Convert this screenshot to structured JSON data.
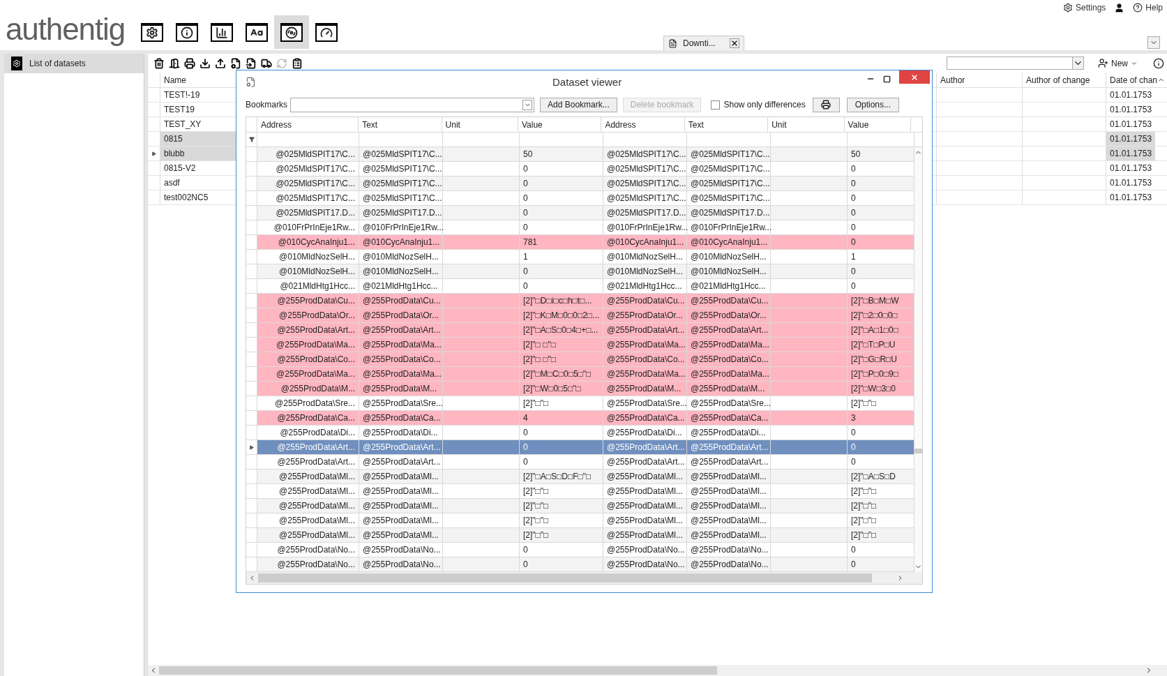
{
  "header": {
    "logo": "authentig",
    "links": [
      {
        "kind": "settings",
        "label": "Settings"
      },
      {
        "kind": "help",
        "label": "Help"
      }
    ]
  },
  "module_tabs": [
    {
      "kind": "settings",
      "selected": false
    },
    {
      "kind": "info",
      "selected": false
    },
    {
      "kind": "chart",
      "selected": false
    },
    {
      "kind": "font",
      "selected": false
    },
    {
      "kind": "disc",
      "selected": true
    },
    {
      "kind": "clock",
      "selected": false
    }
  ],
  "doc_tabs": [
    {
      "label": "Downti..."
    }
  ],
  "sidebar": {
    "items": [
      {
        "label": "List of datasets",
        "selected": true
      }
    ]
  },
  "toolbar": {
    "new_button": "New"
  },
  "main_grid": {
    "columns": [
      "Name",
      "Author",
      "Author of change",
      "Date of chan"
    ],
    "rows": [
      {
        "name": "TEST!-19",
        "date": "01.01.1753",
        "selected": false,
        "current": false
      },
      {
        "name": "TEST19",
        "date": "01.01.1753",
        "selected": false,
        "current": false
      },
      {
        "name": "TEST_XY",
        "date": "01.01.1753",
        "selected": false,
        "current": false
      },
      {
        "name": "0815",
        "date": "01.01.1753",
        "selected": true,
        "current": false
      },
      {
        "name": "blubb",
        "date": "01.01.1753",
        "selected": true,
        "current": true
      },
      {
        "name": "0815-V2",
        "date": "01.01.1753",
        "selected": false,
        "current": false
      },
      {
        "name": "asdf",
        "date": "01.01.1753",
        "selected": false,
        "current": false
      },
      {
        "name": "test002NC5",
        "date": "01.01.1753",
        "selected": false,
        "current": false
      }
    ]
  },
  "dialog": {
    "title": "Dataset viewer",
    "bookmarks_label": "Bookmarks",
    "buttons": [
      {
        "label": "Add Bookmark...",
        "disabled": false
      },
      {
        "label": "Delete bookmark",
        "disabled": true
      }
    ],
    "show_only_differences": {
      "label": "Show only differences",
      "checked": false
    },
    "options_button": "Options...",
    "columns": [
      "Address",
      "Text",
      "Unit",
      "Value",
      "Address",
      "Text",
      "Unit",
      "Value"
    ],
    "rows": [
      {
        "address": "@025MldSPIT17\\C...",
        "text": "@025MldSPIT17\\C...",
        "value": "50",
        "address_2": "@025MldSPIT17\\C...",
        "text_2": "@025MldSPIT17\\C...",
        "value_2": "50",
        "differs": false,
        "selected": false
      },
      {
        "address": "@025MldSPIT17\\C...",
        "text": "@025MldSPIT17\\C...",
        "value": "0",
        "address_2": "@025MldSPIT17\\C...",
        "text_2": "@025MldSPIT17\\C...",
        "value_2": "0",
        "differs": false,
        "selected": false
      },
      {
        "address": "@025MldSPIT17\\C...",
        "text": "@025MldSPIT17\\C...",
        "value": "0",
        "address_2": "@025MldSPIT17\\C...",
        "text_2": "@025MldSPIT17\\C...",
        "value_2": "0",
        "differs": false,
        "selected": false
      },
      {
        "address": "@025MldSPIT17\\C...",
        "text": "@025MldSPIT17\\C...",
        "value": "0",
        "address_2": "@025MldSPIT17\\C...",
        "text_2": "@025MldSPIT17\\C...",
        "value_2": "0",
        "differs": false,
        "selected": false
      },
      {
        "address": "@025MldSPIT17.D...",
        "text": "@025MldSPIT17.D...",
        "value": "0",
        "address_2": "@025MldSPIT17.D...",
        "text_2": "@025MldSPIT17.D...",
        "value_2": "0",
        "differs": false,
        "selected": false
      },
      {
        "address": "@010FrPrInEje1Rw...",
        "text": "@010FrPrInEje1Rw...",
        "value": "0",
        "address_2": "@010FrPrInEje1Rw...",
        "text_2": "@010FrPrInEje1Rw...",
        "value_2": "0",
        "differs": false,
        "selected": false
      },
      {
        "address": "@010CycAnaInju1...",
        "text": "@010CycAnaInju1...",
        "value": "781",
        "address_2": "@010CycAnaInju1...",
        "text_2": "@010CycAnaInju1...",
        "value_2": "0",
        "differs": true,
        "selected": false
      },
      {
        "address": "@010MldNozSelH...",
        "text": "@010MldNozSelH...",
        "value": "1",
        "address_2": "@010MldNozSelH...",
        "text_2": "@010MldNozSelH...",
        "value_2": "1",
        "differs": false,
        "selected": false
      },
      {
        "address": "@010MldNozSelH...",
        "text": "@010MldNozSelH...",
        "value": "0",
        "address_2": "@010MldNozSelH...",
        "text_2": "@010MldNozSelH...",
        "value_2": "0",
        "differs": false,
        "selected": false
      },
      {
        "address": "@021MldHtg1Hcc...",
        "text": "@021MldHtg1Hcc...",
        "value": "0",
        "address_2": "@021MldHtg1Hcc...",
        "text_2": "@021MldHtg1Hcc...",
        "value_2": "0",
        "differs": false,
        "selected": false
      },
      {
        "address": "@255ProdData\\Cu...",
        "text": "@255ProdData\\Cu...",
        "value": "[2]\"□D□i□c□h□t□...",
        "address_2": "@255ProdData\\Cu...",
        "text_2": "@255ProdData\\Cu...",
        "value_2": "[2]\"□B□M□W",
        "differs": true,
        "selected": false
      },
      {
        "address": "@255ProdData\\Or...",
        "text": "@255ProdData\\Or...",
        "value": "[2]\"□K□M□0□0□2□...",
        "address_2": "@255ProdData\\Or...",
        "text_2": "@255ProdData\\Or...",
        "value_2": "[2]\"□2□0□0□",
        "differs": true,
        "selected": false
      },
      {
        "address": "@255ProdData\\Art...",
        "text": "@255ProdData\\Art...",
        "value": "[2]\"□A□S□0□4□+□...",
        "address_2": "@255ProdData\\Art...",
        "text_2": "@255ProdData\\Art...",
        "value_2": "[2]\"□A□1□0□",
        "differs": true,
        "selected": false
      },
      {
        "address": "@255ProdData\\Ma...",
        "text": "@255ProdData\\Ma...",
        "value": "[2]\"□ □\"□",
        "address_2": "@255ProdData\\Ma...",
        "text_2": "@255ProdData\\Ma...",
        "value_2": "[2]\"□T□P□U",
        "differs": true,
        "selected": false
      },
      {
        "address": "@255ProdData\\Co...",
        "text": "@255ProdData\\Co...",
        "value": "[2]\"□ □\"□",
        "address_2": "@255ProdData\\Co...",
        "text_2": "@255ProdData\\Co...",
        "value_2": "[2]\"□G□R□U",
        "differs": true,
        "selected": false
      },
      {
        "address": "@255ProdData\\Ma...",
        "text": "@255ProdData\\Ma...",
        "value": "[2]\"□M□C□0□5□\"□",
        "address_2": "@255ProdData\\Ma...",
        "text_2": "@255ProdData\\Ma...",
        "value_2": "[2]\"□P□0□9□",
        "differs": true,
        "selected": false
      },
      {
        "address": "@255ProdData\\M...",
        "text": "@255ProdData\\M...",
        "value": "[2]\"□W□0□5□\"□",
        "address_2": "@255ProdData\\M...",
        "text_2": "@255ProdData\\M...",
        "value_2": "[2]\"□W□3□0",
        "differs": true,
        "selected": false
      },
      {
        "address": "@255ProdData\\Sre...",
        "text": "@255ProdData\\Sre...",
        "value": "[2]\"□\"□",
        "address_2": "@255ProdData\\Sre...",
        "text_2": "@255ProdData\\Sre...",
        "value_2": "[2]\"□\"□",
        "differs": false,
        "selected": false
      },
      {
        "address": "@255ProdData\\Ca...",
        "text": "@255ProdData\\Ca...",
        "value": "4",
        "address_2": "@255ProdData\\Ca...",
        "text_2": "@255ProdData\\Ca...",
        "value_2": "3",
        "differs": true,
        "selected": false
      },
      {
        "address": "@255ProdData\\Di...",
        "text": "@255ProdData\\Di...",
        "value": "0",
        "address_2": "@255ProdData\\Di...",
        "text_2": "@255ProdData\\Di...",
        "value_2": "0",
        "differs": false,
        "selected": false
      },
      {
        "address": "@255ProdData\\Art...",
        "text": "@255ProdData\\Art...",
        "value": "0",
        "address_2": "@255ProdData\\Art...",
        "text_2": "@255ProdData\\Art...",
        "value_2": "0",
        "differs": false,
        "selected": true
      },
      {
        "address": "@255ProdData\\Art...",
        "text": "@255ProdData\\Art...",
        "value": "0",
        "address_2": "@255ProdData\\Art...",
        "text_2": "@255ProdData\\Art...",
        "value_2": "0",
        "differs": false,
        "selected": false
      },
      {
        "address": "@255ProdData\\Ml...",
        "text": "@255ProdData\\Ml...",
        "value": "[2]\"□A□S□D□F□\"□",
        "address_2": "@255ProdData\\Ml...",
        "text_2": "@255ProdData\\Ml...",
        "value_2": "[2]\"□A□S□D",
        "differs": false,
        "selected": false
      },
      {
        "address": "@255ProdData\\Ml...",
        "text": "@255ProdData\\Ml...",
        "value": "[2]\"□\"□",
        "address_2": "@255ProdData\\Ml...",
        "text_2": "@255ProdData\\Ml...",
        "value_2": "[2]\"□\"□",
        "differs": false,
        "selected": false
      },
      {
        "address": "@255ProdData\\Ml...",
        "text": "@255ProdData\\Ml...",
        "value": "[2]\"□\"□",
        "address_2": "@255ProdData\\Ml...",
        "text_2": "@255ProdData\\Ml...",
        "value_2": "[2]\"□\"□",
        "differs": false,
        "selected": false
      },
      {
        "address": "@255ProdData\\Ml...",
        "text": "@255ProdData\\Ml...",
        "value": "[2]\"□\"□",
        "address_2": "@255ProdData\\Ml...",
        "text_2": "@255ProdData\\Ml...",
        "value_2": "[2]\"□\"□",
        "differs": false,
        "selected": false
      },
      {
        "address": "@255ProdData\\Ml...",
        "text": "@255ProdData\\Ml...",
        "value": "[2]\"□\"□",
        "address_2": "@255ProdData\\Ml...",
        "text_2": "@255ProdData\\Ml...",
        "value_2": "[2]\"□\"□",
        "differs": false,
        "selected": false
      },
      {
        "address": "@255ProdData\\No...",
        "text": "@255ProdData\\No...",
        "value": "0",
        "address_2": "@255ProdData\\No...",
        "text_2": "@255ProdData\\No...",
        "value_2": "0",
        "differs": false,
        "selected": false
      },
      {
        "address": "@255ProdData\\No...",
        "text": "@255ProdData\\No...",
        "value": "0",
        "address_2": "@255ProdData\\No...",
        "text_2": "@255ProdData\\No...",
        "value_2": "0",
        "differs": false,
        "selected": false
      }
    ]
  }
}
